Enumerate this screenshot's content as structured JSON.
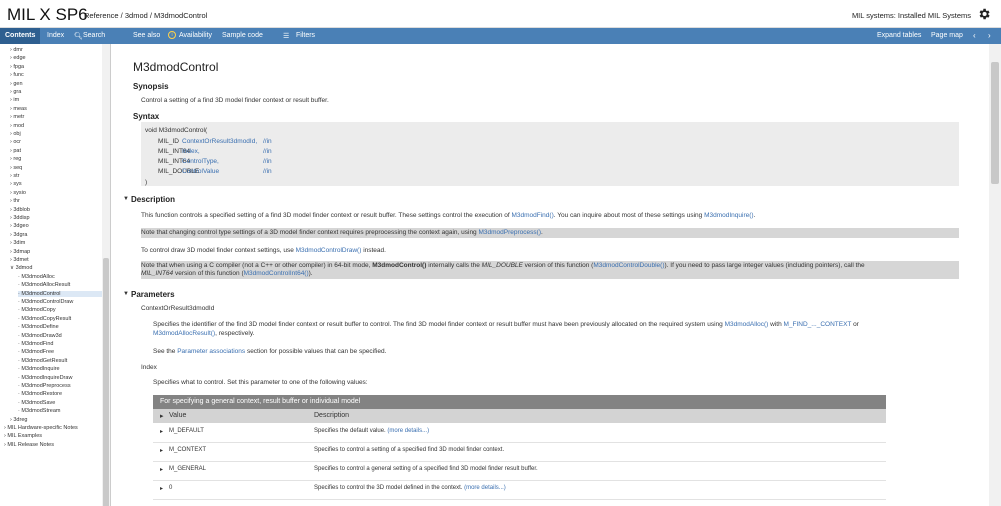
{
  "header": {
    "brand": "MIL X SP6",
    "breadcrumb": "Reference / 3dmod / M3dmodControl",
    "systems": "MIL systems: Installed MIL Systems"
  },
  "navbar": {
    "contents": "Contents",
    "index": "Index",
    "search": "Search",
    "see_also": "See also",
    "availability": "Availability",
    "sample_code": "Sample code",
    "filters": "Filters",
    "expand_tables": "Expand tables",
    "page_map": "Page map"
  },
  "sidebar": {
    "modules": [
      "dmr",
      "edge",
      "fpga",
      "func",
      "gen",
      "gra",
      "im",
      "meas",
      "metr",
      "mod",
      "obj",
      "ocr",
      "pat",
      "reg",
      "seq",
      "str",
      "sys",
      "sysio",
      "thr",
      "3dblob",
      "3ddisp",
      "3dgeo",
      "3dgra",
      "3dim",
      "3dmap",
      "3dmet",
      "3dmod"
    ],
    "open_module": "3dmod",
    "functions": [
      "M3dmodAlloc",
      "M3dmodAllocResult",
      "M3dmodControl",
      "M3dmodControlDraw",
      "M3dmodCopy",
      "M3dmodCopyResult",
      "M3dmodDefine",
      "M3dmodDraw3d",
      "M3dmodFind",
      "M3dmodFree",
      "M3dmodGetResult",
      "M3dmodInquire",
      "M3dmodInquireDraw",
      "M3dmodPreprocess",
      "M3dmodRestore",
      "M3dmodSave",
      "M3dmodStream"
    ],
    "selected": "M3dmodControl",
    "after": [
      "3dreg"
    ],
    "footer": [
      "MIL Hardware-specific Notes",
      "MIL Examples",
      "MIL Release Notes"
    ]
  },
  "main": {
    "title": "M3dmodControl",
    "synopsis_heading": "Synopsis",
    "synopsis": "Control a setting of a find 3D model finder context or result buffer.",
    "syntax_heading": "Syntax",
    "code": {
      "open": "void M3dmodControl(",
      "params": [
        {
          "type": "MIL_ID",
          "name": "ContextOrResult3dmodId,",
          "dir": "//in"
        },
        {
          "type": "MIL_INT64",
          "name": "Index,",
          "dir": "//in"
        },
        {
          "type": "MIL_INT64",
          "name": "ControlType,",
          "dir": "//in"
        },
        {
          "type": "MIL_DOUBLE",
          "name": "ControlValue",
          "dir": "//in"
        }
      ],
      "close": ")"
    },
    "description_heading": "Description",
    "desc1_a": "This function controls a specified setting of a find 3D model finder context or result buffer. These settings control the execution of ",
    "desc1_link": "M3dmodFind()",
    "desc1_b": ". You can inquire about most of these settings using ",
    "desc1_link2": "M3dmodInquire()",
    "desc1_c": ".",
    "note1_a": "Note that changing control type settings of a 3D model finder context requires preprocessing the context again, using ",
    "note1_link": "M3dmodPreprocess()",
    "note1_b": ".",
    "desc2_a": "To control draw 3D model finder context settings, use ",
    "desc2_link": "M3dmodControlDraw()",
    "desc2_b": " instead.",
    "note2_a": "Note that when using a C compiler (not a C++ or other compiler) in 64-bit mode, ",
    "note2_bold": "M3dmodControl()",
    "note2_b": " internally calls the ",
    "note2_i": "MIL_DOUBLE",
    "note2_c": " version of this function (",
    "note2_link": "M3dmodControlDouble()",
    "note2_d": "). If you need to pass large integer values (including pointers), call the",
    "note2_i2": "MIL_INT64",
    "note2_e": " version of this function (",
    "note2_link2": "M3dmodControlInt64()",
    "note2_f": ").",
    "parameters_heading": "Parameters",
    "param1_name": "ContextOrResult3dmodId",
    "param1_a": "Specifies the identifier of the find 3D model finder context or result buffer to control. The find 3D model finder context or result buffer must have been previously allocated on the required system using ",
    "param1_link": "M3dmodAlloc()",
    "param1_b": " with ",
    "param1_link2": "M_FIND_..._CONTEXT",
    "param1_c": " or",
    "param1_link3": "M3dmodAllocResult()",
    "param1_d": ", respectively.",
    "param1_see_a": "See the ",
    "param1_see_link": "Parameter associations",
    "param1_see_b": " section for possible values that can be specified.",
    "param2_name": "Index",
    "param2_desc": "Specifies what to control. Set this parameter to one of the following values:",
    "table": {
      "caption": "For specifying a general context, result buffer or individual model",
      "col_value": "Value",
      "col_desc": "Description",
      "rows": [
        {
          "value": "M_DEFAULT",
          "desc": "Specifies the default value.",
          "more": "(more details...)"
        },
        {
          "value": "M_CONTEXT",
          "desc": "Specifies to control a setting of a specified find 3D model finder context.",
          "more": ""
        },
        {
          "value": "M_GENERAL",
          "desc": "Specifies to control a general setting of a specified find 3D model finder result buffer.",
          "more": ""
        },
        {
          "value": "0",
          "desc": "Specifies to control the 3D model defined in the context.",
          "more": "(more details...)"
        }
      ]
    }
  }
}
